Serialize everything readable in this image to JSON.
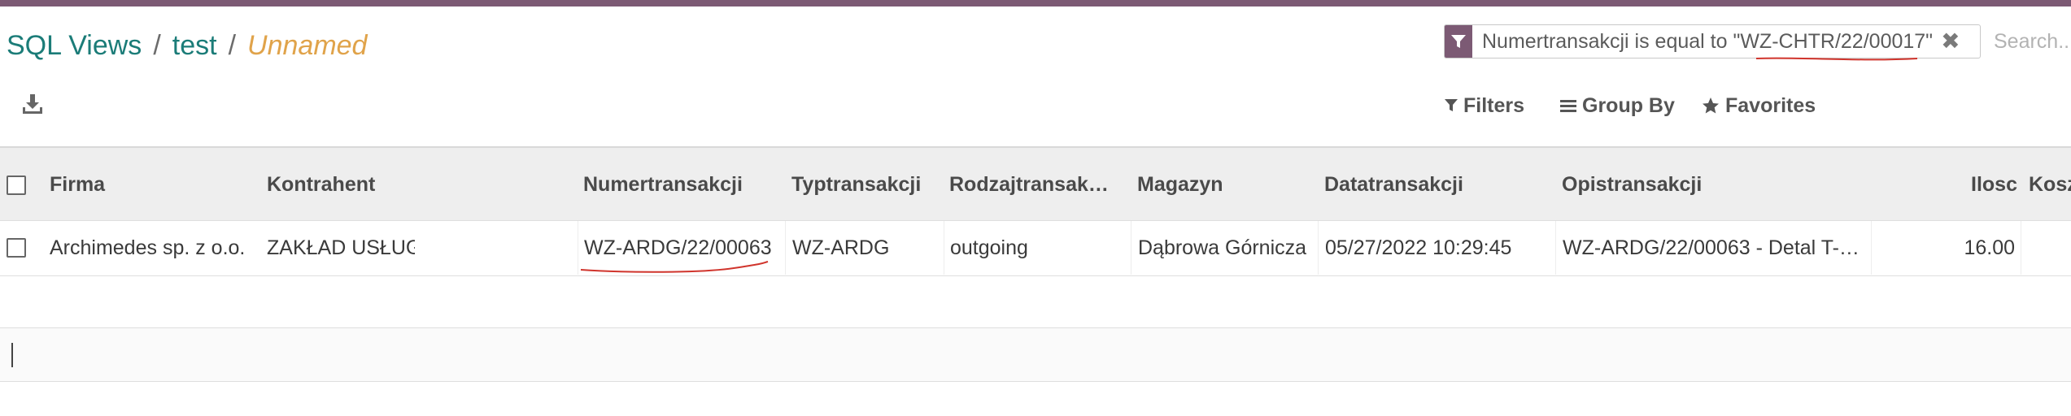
{
  "breadcrumb": {
    "items": [
      "SQL Views",
      "test"
    ],
    "current": "Unnamed",
    "separator": "/"
  },
  "toolbar": {
    "download_icon": "download-icon"
  },
  "search": {
    "facet_icon": "filter-icon",
    "facet_text": "Numertransakcji is equal to \"WZ-CHTR/22/00017\"",
    "remove_icon": "close-icon",
    "placeholder": "Search..."
  },
  "filter_bar": {
    "filters_label": "Filters",
    "group_by_label": "Group By",
    "favorites_label": "Favorites"
  },
  "table": {
    "columns": [
      "Firma",
      "Kontrahent",
      "Numertransakcji",
      "Typtransakcji",
      "Rodzajtransak…",
      "Magazyn",
      "Datatransakcji",
      "Opistransakcji",
      "Ilosc",
      "Kosz"
    ],
    "rows": [
      {
        "firma": "Archimedes sp. z o.o.",
        "kontrahent": "ZAKŁAD USŁUG",
        "numertransakcji": "WZ-ARDG/22/00063",
        "typtransakcji": "WZ-ARDG",
        "rodzajtransakcji": "outgoing",
        "magazyn": "Dąbrowa Górnicza",
        "datatransakcji": "05/27/2022 10:29:45",
        "opistransakcji": "WZ-ARDG/22/00063 - Detal T-…",
        "ilosc": "16.00"
      }
    ]
  },
  "colors": {
    "brand": "#7c5a74",
    "link": "#1b7c78",
    "current": "#e0a34a",
    "annotation": "#d0342c"
  }
}
